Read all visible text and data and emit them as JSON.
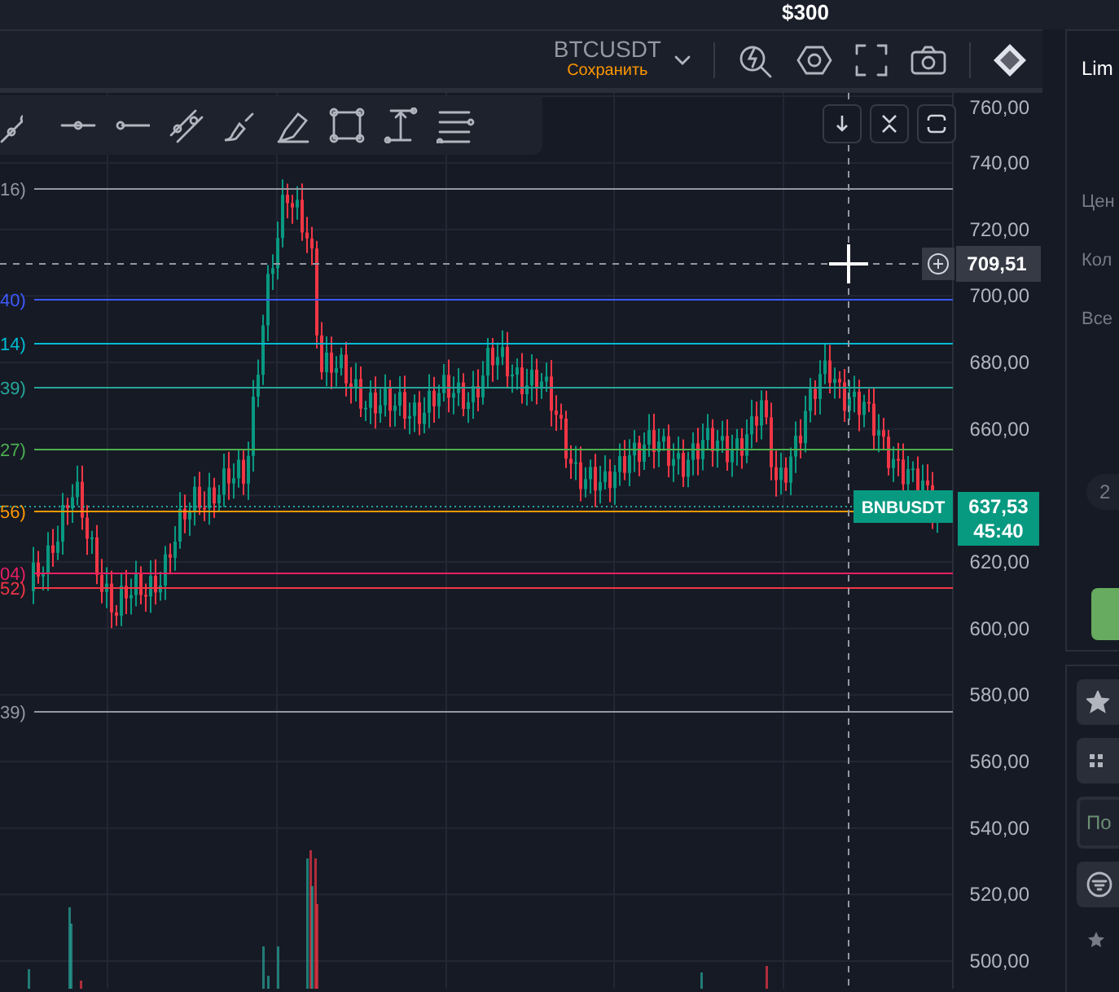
{
  "header": {
    "amount": "$300"
  },
  "toolbar": {
    "symbol": "BTCUSDT",
    "save_label": "Сохранить"
  },
  "price_axis": [
    "760,00",
    "740,00",
    "720,00",
    "700,00",
    "680,00",
    "660,00",
    "620,00",
    "600,00",
    "580,00",
    "560,00",
    "540,00",
    "520,00",
    "500,00"
  ],
  "levels": [
    {
      "label": "16)",
      "color": "#9598a1"
    },
    {
      "label": "40)",
      "color": "#3d5afe"
    },
    {
      "label": "14)",
      "color": "#00bcd4"
    },
    {
      "label": "39)",
      "color": "#26a69a"
    },
    {
      "label": "27)",
      "color": "#4caf50"
    },
    {
      "label": "56)",
      "color": "#ff9800"
    },
    {
      "label": "04)",
      "color": "#e91e63"
    },
    {
      "label": "52)",
      "color": "#f23645"
    },
    {
      "label": "39)",
      "color": "#9598a1"
    }
  ],
  "crosshair": {
    "price": "709,51"
  },
  "last_price": {
    "symbol": "BNBUSDT",
    "price": "637,53",
    "countdown": "45:40"
  },
  "order_panel": {
    "title": "Lim",
    "fields": [
      "Цен",
      "Кол",
      "Все"
    ],
    "pill": "2"
  },
  "market_panel": {
    "search_placeholder": "По"
  }
}
